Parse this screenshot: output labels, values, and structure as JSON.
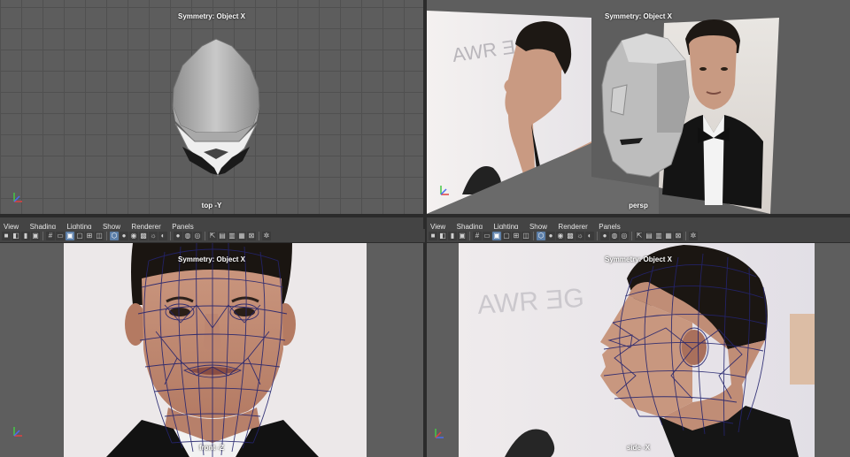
{
  "top_left": {
    "hud_title": "Symmetry: Object X",
    "camera_label": "top -Y"
  },
  "top_right": {
    "hud_title": "Symmetry: Object X",
    "camera_label": "persp"
  },
  "bottom_left": {
    "menu": [
      "View",
      "Shading",
      "Lighting",
      "Show",
      "Renderer",
      "Panels"
    ],
    "hud_title": "Symmetry: Object X",
    "camera_label": "front -Z"
  },
  "bottom_right": {
    "menu": [
      "View",
      "Shading",
      "Lighting",
      "Show",
      "Renderer",
      "Panels"
    ],
    "hud_title": "Symmetry: Object X",
    "camera_label": "side -X"
  },
  "icons": [
    "camera-icon",
    "wireframe-icon",
    "smooth-shade-icon",
    "texture-icon",
    "light-icon",
    "shadow-icon",
    "grid-icon",
    "xray-icon",
    "isolate-icon",
    "resolution-gate-icon"
  ],
  "colors": {
    "viewport_bg": "#5e5e5e",
    "wire": "#24246e",
    "accent": "#5b7ea8"
  }
}
